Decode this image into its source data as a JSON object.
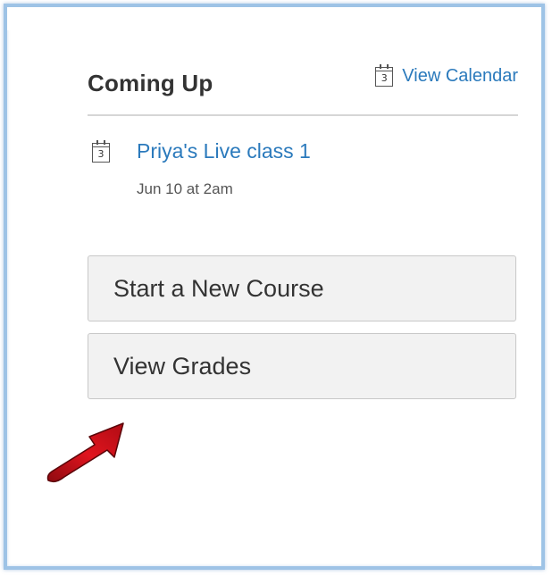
{
  "coming_up": {
    "title": "Coming Up",
    "view_calendar_label": "View Calendar",
    "calendar_icon_number": "3"
  },
  "events": [
    {
      "icon_number": "3",
      "title": "Priya's Live class 1",
      "date": "Jun 10 at 2am"
    }
  ],
  "actions": {
    "start_new_course": "Start a New Course",
    "view_grades": "View Grades"
  },
  "colors": {
    "link": "#2b7abc",
    "frame_border": "#9ec3e6",
    "button_bg": "#f2f2f2",
    "arrow": "#d0101a"
  },
  "annotation": {
    "icon": "red-arrow-icon",
    "points_to": "View Grades"
  }
}
